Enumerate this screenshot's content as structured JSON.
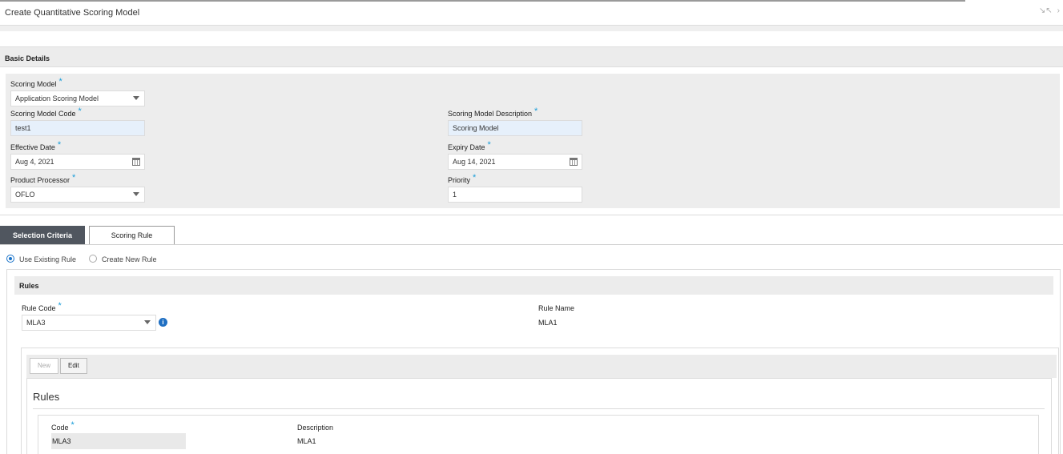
{
  "window": {
    "title": "Create Quantitative Scoring Model",
    "icons": [
      "minimize-icon",
      "close-icon"
    ]
  },
  "basic_details": {
    "section_title": "Basic Details",
    "scoring_model": {
      "label": "Scoring Model",
      "required": "*",
      "value": "Application Scoring Model"
    },
    "scoring_model_code": {
      "label": "Scoring Model Code",
      "required": "*",
      "value": "test1"
    },
    "scoring_model_description": {
      "label": "Scoring Model Description",
      "required": "*",
      "value": "Scoring Model"
    },
    "effective_date": {
      "label": "Effective Date",
      "required": "*",
      "value": "Aug 4, 2021"
    },
    "expiry_date": {
      "label": "Expiry Date",
      "required": "*",
      "value": "Aug 14, 2021"
    },
    "product_processor": {
      "label": "Product Processor",
      "required": "*",
      "value": "OFLO"
    },
    "priority": {
      "label": "Priority",
      "required": "*",
      "value": "1"
    }
  },
  "tabs": [
    {
      "label": "Selection Criteria",
      "active": true
    },
    {
      "label": "Scoring Rule",
      "active": false
    }
  ],
  "rule_options": {
    "use_existing": {
      "label": "Use Existing Rule",
      "selected": true
    },
    "create_new": {
      "label": "Create New Rule",
      "selected": false
    }
  },
  "rules_section": {
    "title": "Rules",
    "rule_code": {
      "label": "Rule Code",
      "required": "*",
      "value": "MLA3"
    },
    "rule_name": {
      "label": "Rule Name",
      "value": "MLA1"
    }
  },
  "rules_toolbar": {
    "new_label": "New",
    "edit_label": "Edit"
  },
  "rules_card": {
    "title": "Rules",
    "code": {
      "label": "Code",
      "required": "*",
      "value": "MLA3"
    },
    "description": {
      "label": "Description",
      "value": "MLA1"
    }
  },
  "colors": {
    "accent": "#1a9dd9",
    "active_tab": "#50565f",
    "panel": "#ededed",
    "input_highlight": "#e6f0fb"
  }
}
